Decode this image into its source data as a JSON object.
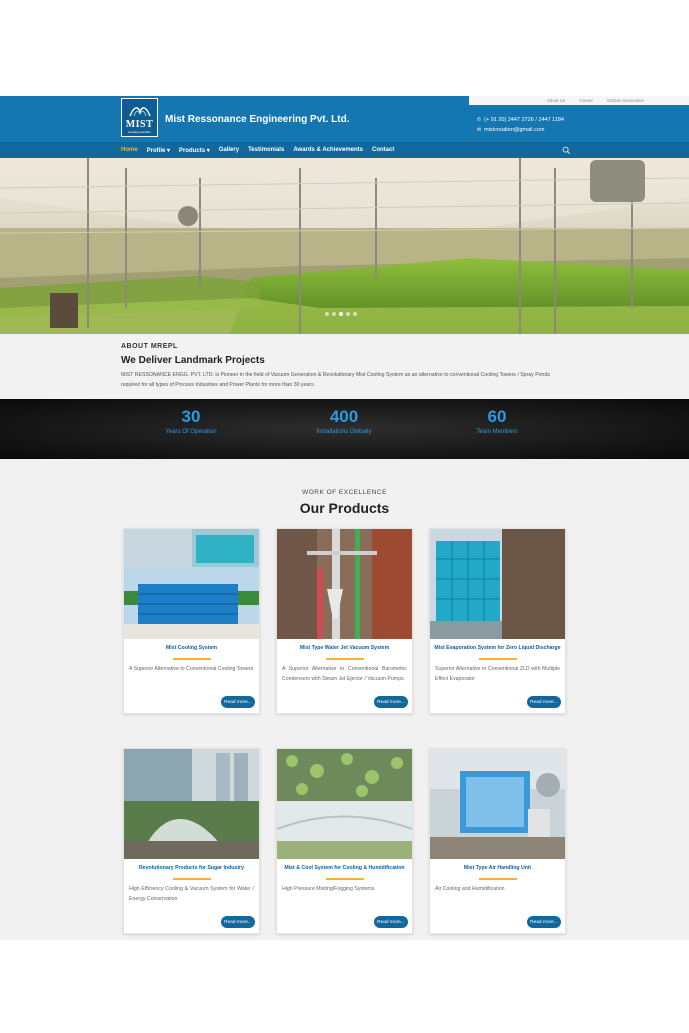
{
  "utility_links": [
    "About Us",
    "Career",
    "Global Association"
  ],
  "logo": {
    "text": "MIST",
    "subtext": "creating wonders"
  },
  "company_name": "Mist Ressonance Engineering Pvt. Ltd.",
  "contact": {
    "phone": "(+ 91 20) 2447 2726 / 2447 1184",
    "email": "mistcreation@gmail.com"
  },
  "nav": {
    "items": [
      "Home",
      "Profile ▾",
      "Products ▾",
      "Gallery",
      "Testimonials",
      "Awards & Achievements",
      "Contact"
    ],
    "active": "Home"
  },
  "hero": {
    "slide_count": 5,
    "active_slide": 3
  },
  "about": {
    "kicker": "ABOUT MREPL",
    "title": "We Deliver Landmark Projects",
    "text": "MIST RESSONANCE ENGG. PVT. LTD. is Pioneer in the field of Vacuum Generation & Revolutionary Mist Cooling System as an alternative to conventional Cooling Towers / Spray Ponds required for all types of Process Industries and Power Plants for more than 30 years."
  },
  "stats": [
    {
      "number": "30",
      "label": "Years Of Operation"
    },
    {
      "number": "400",
      "label": "Installations Globally"
    },
    {
      "number": "60",
      "label": "Team Members"
    }
  ],
  "products_section": {
    "kicker": "WORK OF EXCELLENCE",
    "title": "Our Products",
    "read_more": "Read more...",
    "items": [
      {
        "title": "Mist Cooling System",
        "desc": "A Superior Alternative to Conventional Cooling Towers"
      },
      {
        "title": "Mist Type Water Jet Vacuum System",
        "desc": "A Superior Alternative to Conventional Barometric Condensers with Steam Jet Ejector / Vacuum Pumps."
      },
      {
        "title": "Mist Evaporation System for Zero Liquid Discharge",
        "desc": "Superior Alternative to Conventional ZLD with Multiple Effect Evaporator"
      },
      {
        "title": "Revolutionary Products for Sugar Industry",
        "desc": "High Efficiency Cooling & Vacuum System for Water / Energy Conservation"
      },
      {
        "title": "Mist & Cool System for Cooling & Humidification",
        "desc": "High Pressure Misting/Fogging Systems"
      },
      {
        "title": "Mist Type Air Handling Unit",
        "desc": "Air Cooling and Humidification"
      }
    ]
  },
  "colors": {
    "brand_blue": "#1577b2",
    "nav_blue": "#10689f",
    "accent": "#f5b234",
    "stat_blue": "#2b9be4"
  }
}
